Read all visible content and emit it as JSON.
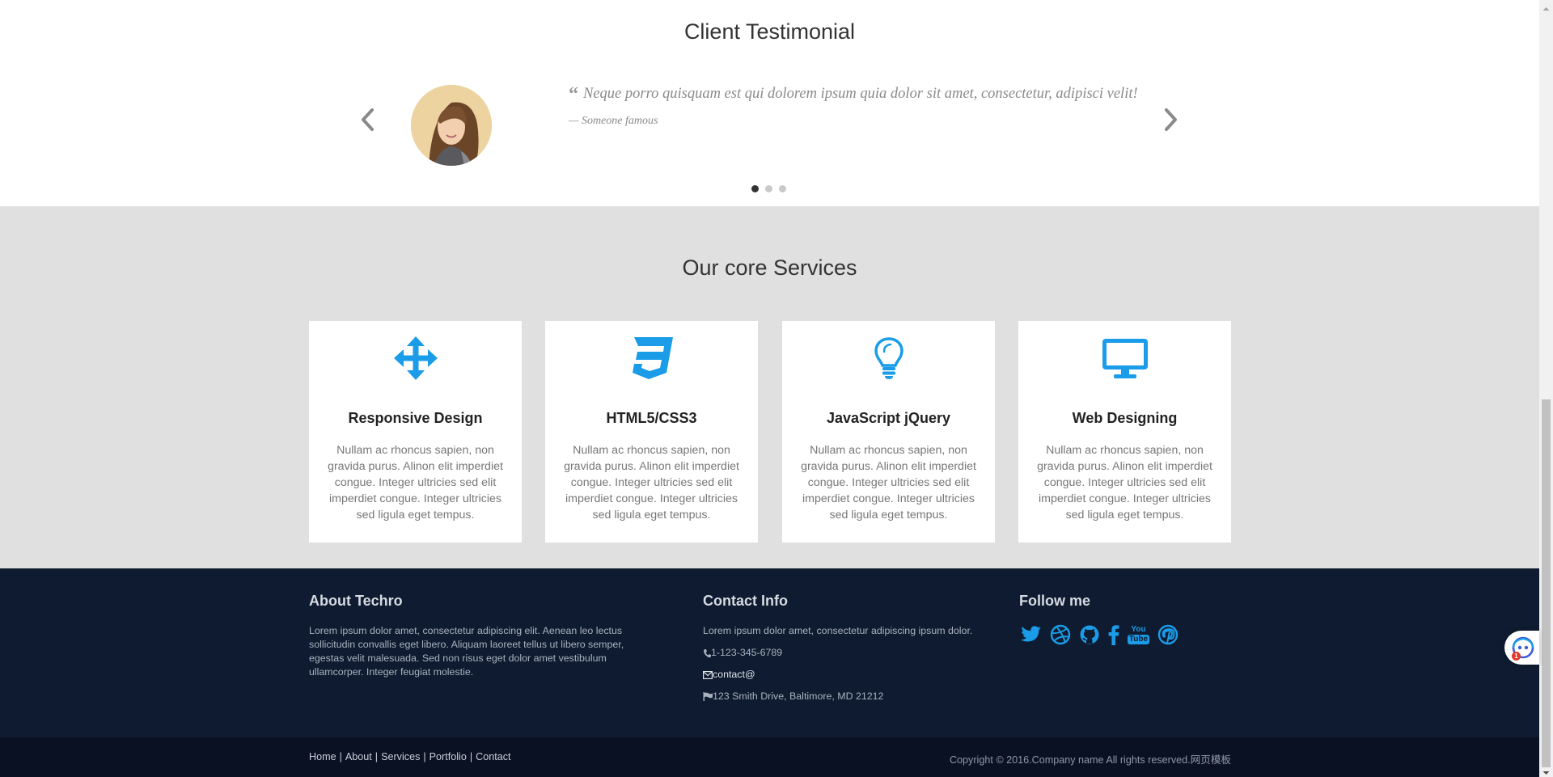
{
  "testimonial": {
    "title": "Client Testimonial",
    "quote_mark": "“",
    "quote": "Neque porro quisquam est qui dolorem ipsum quia dolor sit amet, consectetur, adipisci velit!",
    "author": "— Someone famous",
    "active_slide": 1,
    "slide_count": 3
  },
  "services": {
    "title": "Our core Services",
    "accent_color": "#1a9ce8",
    "cards": [
      {
        "icon": "arrows-move-icon",
        "title": "Responsive Design",
        "text": "Nullam ac rhoncus sapien, non gravida purus. Alinon elit imperdiet congue. Integer ultricies sed elit imperdiet congue. Integer ultricies sed ligula eget tempus."
      },
      {
        "icon": "css3-icon",
        "title": "HTML5/CSS3",
        "text": "Nullam ac rhoncus sapien, non gravida purus. Alinon elit imperdiet congue. Integer ultricies sed elit imperdiet congue. Integer ultricies sed ligula eget tempus."
      },
      {
        "icon": "lightbulb-icon",
        "title": "JavaScript jQuery",
        "text": "Nullam ac rhoncus sapien, non gravida purus. Alinon elit imperdiet congue. Integer ultricies sed elit imperdiet congue. Integer ultricies sed ligula eget tempus."
      },
      {
        "icon": "desktop-monitor-icon",
        "title": "Web Designing",
        "text": "Nullam ac rhoncus sapien, non gravida purus. Alinon elit imperdiet congue. Integer ultricies sed elit imperdiet congue. Integer ultricies sed ligula eget tempus."
      }
    ]
  },
  "footer": {
    "about": {
      "title": "About Techro",
      "text": "Lorem ipsum dolor amet, consectetur adipiscing elit. Aenean leo lectus sollicitudin convallis eget libero. Aliquam laoreet tellus ut libero semper, egestas velit malesuada. Sed non risus eget dolor amet vestibulum ullamcorper. Integer feugiat molestie."
    },
    "contact": {
      "title": "Contact Info",
      "intro": "Lorem ipsum dolor amet, consectetur adipiscing ipsum dolor.",
      "phone": "1-123-345-6789",
      "email": "contact@",
      "address": "123 Smith Drive, Baltimore, MD 21212"
    },
    "follow": {
      "title": "Follow me",
      "icons": [
        "twitter-icon",
        "dribbble-icon",
        "github-icon",
        "facebook-icon",
        "youtube-icon",
        "pinterest-icon"
      ],
      "youtube_text_top": "You",
      "youtube_text_bottom": "Tube"
    },
    "bottom_nav": {
      "home": "Home",
      "about": "About",
      "services": "Services",
      "portfolio": "Portfolio",
      "contact": "Contact",
      "separator": "|"
    },
    "copyright": "Copyright © 2016.Company name All rights reserved.",
    "copyright_link": "网页模板"
  },
  "widget": {
    "badge": "1"
  },
  "colors": {
    "footer_bg": "#0e1b30",
    "bottom_bar_bg": "#0a1122",
    "services_bg": "#e0e0e0",
    "icon_blue": "#1a9ce8"
  }
}
